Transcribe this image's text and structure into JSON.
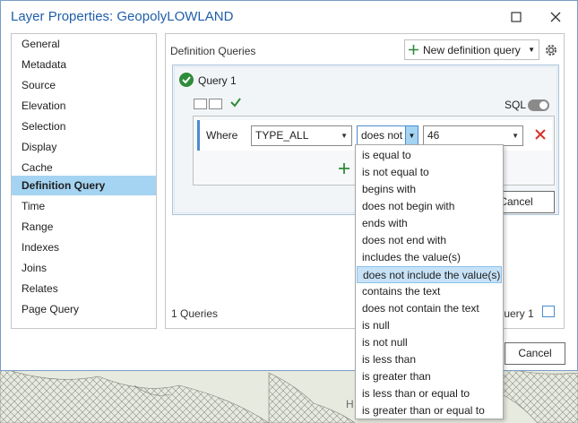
{
  "window": {
    "title": "Layer Properties: GeopolyLOWLAND",
    "minimize_icon": "minimize-icon",
    "close_icon": "close-icon"
  },
  "sidebar": {
    "items": [
      {
        "label": "General"
      },
      {
        "label": "Metadata"
      },
      {
        "label": "Source"
      },
      {
        "label": "Elevation"
      },
      {
        "label": "Selection"
      },
      {
        "label": "Display"
      },
      {
        "label": "Cache"
      },
      {
        "label": "Definition Query",
        "selected": true
      },
      {
        "label": "Time"
      },
      {
        "label": "Range"
      },
      {
        "label": "Indexes"
      },
      {
        "label": "Joins"
      },
      {
        "label": "Relates"
      },
      {
        "label": "Page Query"
      }
    ]
  },
  "main": {
    "section_label": "Definition Queries",
    "new_query_label": "New definition query",
    "query": {
      "name": "Query 1",
      "sql_label": "SQL",
      "where_label": "Where",
      "field_value": "TYPE_ALL",
      "operator_value": "does not",
      "value_value": "46",
      "cancel_label": "Cancel"
    },
    "footer_count": "1 Queries",
    "footer_active": "Query 1"
  },
  "dialog_cancel_label": "Cancel",
  "operator_options": [
    "is equal to",
    "is not equal to",
    "begins with",
    "does not begin with",
    "ends with",
    "does not end with",
    "includes the value(s)",
    "does not include the value(s)",
    "contains the text",
    "does not contain the text",
    "is null",
    "is not null",
    "is less than",
    "is greater than",
    "is less than or equal to",
    "is greater than or equal to"
  ],
  "highlighted_option_index": 7,
  "map_label": "H",
  "colors": {
    "accent": "#1f5fa8",
    "selected_bg": "#a5d4f2",
    "success": "#2e8b3a",
    "delete": "#d9302c"
  }
}
